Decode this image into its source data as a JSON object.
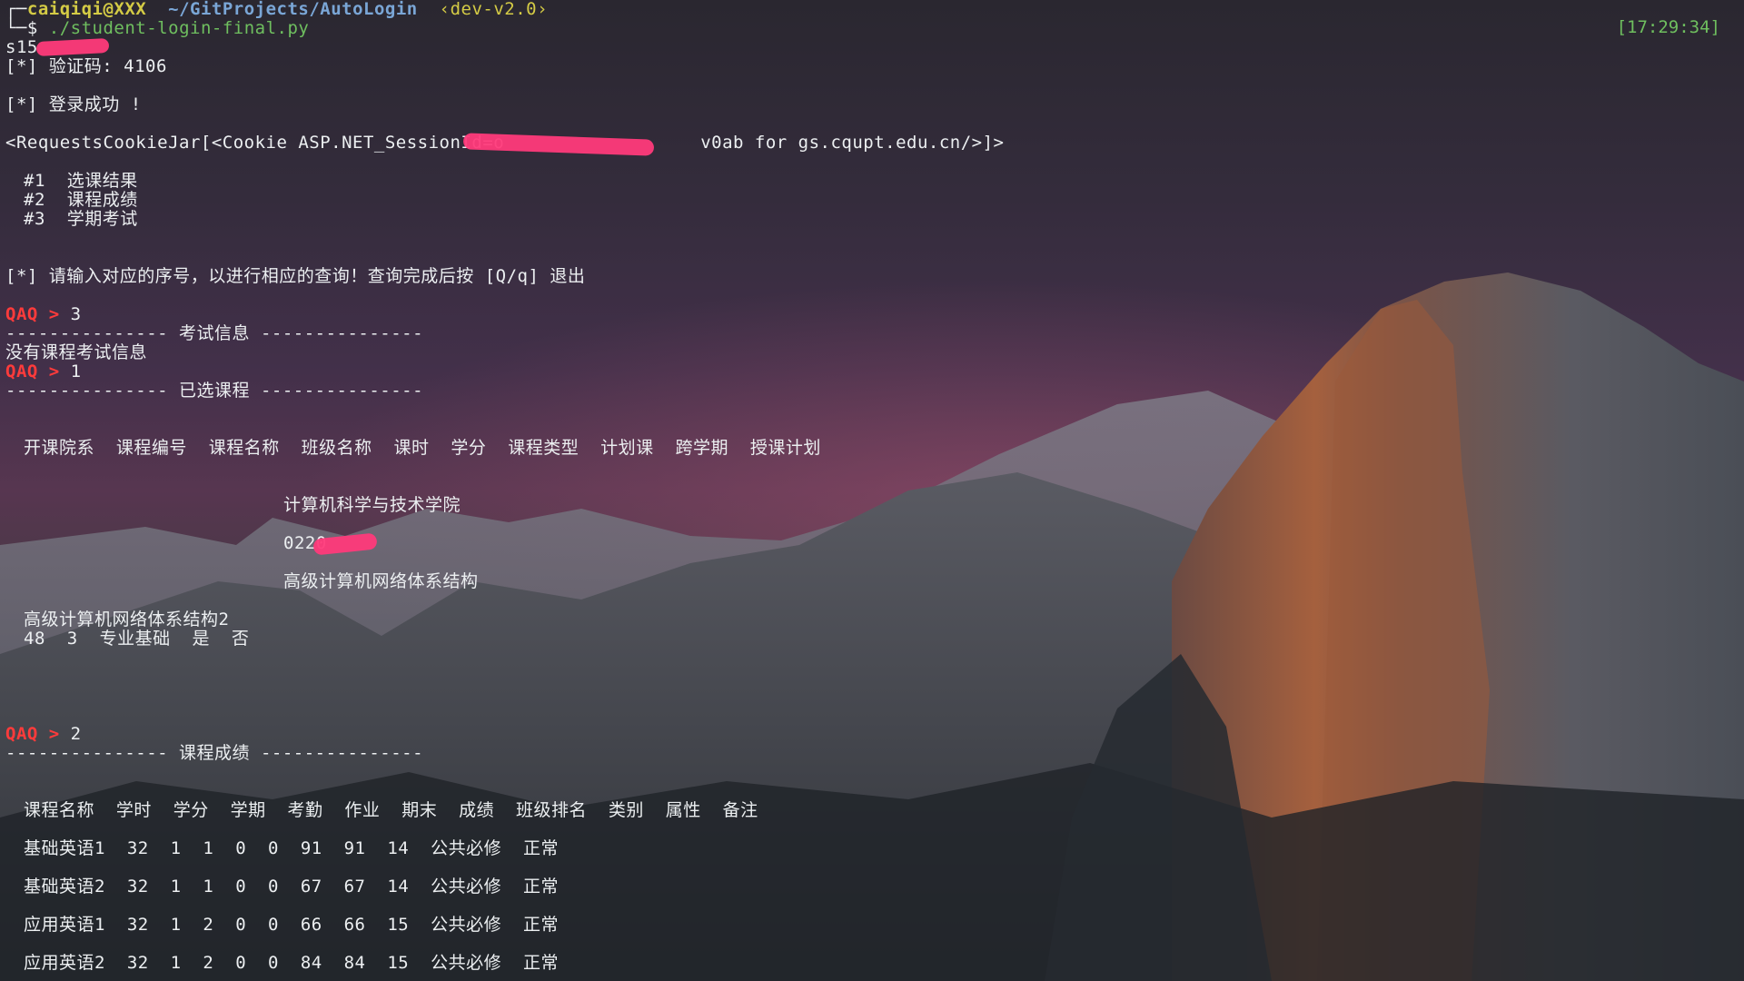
{
  "prompt_line": {
    "user": "caiqiqi@XXX",
    "path": "~/GitProjects/AutoLogin",
    "branch": "‹dev-v2.0›",
    "command": "./student-login-final.py",
    "dollar": "$",
    "time": "[17:29:34]"
  },
  "output": {
    "student_id": "s15",
    "captcha": "[*] 验证码: 4106",
    "login_ok": "[*] 登录成功 !",
    "cookie_prefix": "<RequestsCookieJar[<Cookie ASP.NET_SessionId=o",
    "cookie_suffix": "v0ab for gs.cqupt.edu.cn/>]>",
    "menu": [
      "#1  选课结果",
      "#2  课程成绩",
      "#3  学期考试"
    ],
    "instruction": "[*] 请输入对应的序号，以进行相应的查询！查询完成后按 [Q/q] 退出",
    "qaq": "QAQ > ",
    "input1": "3",
    "exam_header": "--------------- 考试信息 ---------------",
    "no_exam": "没有课程考试信息",
    "input2": "1",
    "course_header": "--------------- 已选课程 ---------------",
    "course_cols": "开课院系  课程编号  课程名称  班级名称  课时  学分  课程类型  计划课  跨学期  授课计划",
    "course_dept": "计算机科学与技术学院",
    "course_id": "0220",
    "course_name": "高级计算机网络体系结构",
    "course_class": "高级计算机网络体系结构2",
    "course_rest": "48  3  专业基础  是  否",
    "input3": "2",
    "grade_header": "--------------- 课程成绩 ---------------",
    "grade_cols": "课程名称  学时  学分  学期  考勤  作业  期末  成绩  班级排名  类别  属性  备注",
    "grades": [
      "基础英语1  32  1  1  0  0  91  91  14  公共必修  正常",
      "基础英语2  32  1  1  0  0  67  67  14  公共必修  正常",
      "应用英语1  32  1  2  0  0  66  66  15  公共必修  正常",
      "应用英语2  32  1  2  0  0  84  84  15  公共必修  正常"
    ]
  }
}
